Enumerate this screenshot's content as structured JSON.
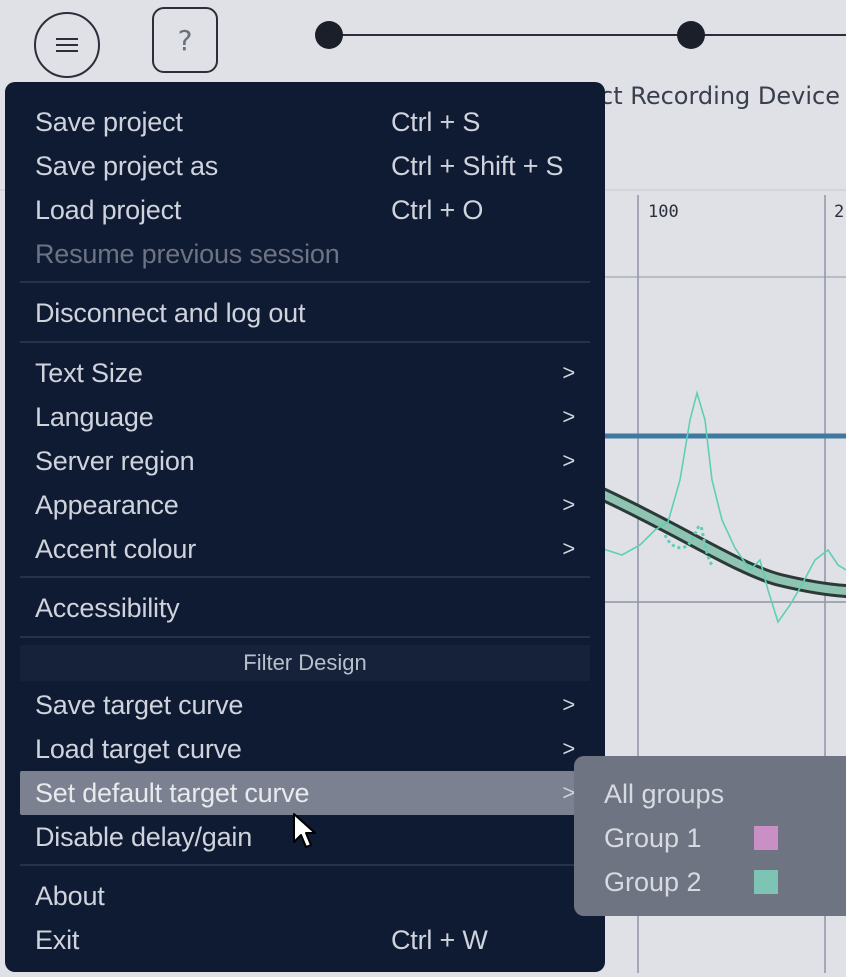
{
  "header": {
    "help_glyph": "?",
    "step_label": "ct Recording Device"
  },
  "graph": {
    "x_ticks": [
      "100",
      "2"
    ],
    "colors": {
      "grid": "#8f96a6",
      "blue_line": "#3f79a0",
      "target_curve": "#2b3a36",
      "target_curve_fill": "#8fc4b2",
      "measurement": "#5fcfb4"
    }
  },
  "menu": {
    "items": [
      {
        "label": "Save project",
        "shortcut": "Ctrl + S"
      },
      {
        "label": "Save project as",
        "shortcut": "Ctrl + Shift + S"
      },
      {
        "label": "Load project",
        "shortcut": "Ctrl + O"
      },
      {
        "label": "Resume previous session",
        "disabled": true
      },
      {
        "label": "Disconnect and log out"
      },
      {
        "label": "Text Size",
        "arrow": ">"
      },
      {
        "label": "Language",
        "arrow": ">"
      },
      {
        "label": "Server region",
        "arrow": ">"
      },
      {
        "label": "Appearance",
        "arrow": ">"
      },
      {
        "label": "Accent colour",
        "arrow": ">"
      },
      {
        "label": "Accessibility"
      },
      {
        "label": "Save target curve",
        "arrow": ">"
      },
      {
        "label": "Load target curve",
        "arrow": ">"
      },
      {
        "label": "Set default target curve",
        "arrow": ">",
        "highlighted": true
      },
      {
        "label": "Disable delay/gain"
      },
      {
        "label": "About"
      },
      {
        "label": "Exit",
        "shortcut": "Ctrl + W"
      }
    ],
    "section_header": "Filter Design",
    "colors": {
      "bg": "#0f1a33",
      "highlight": "#7b8190"
    }
  },
  "submenu": {
    "items": [
      {
        "label": "All groups"
      },
      {
        "label": "Group 1",
        "swatch": "#c890c4"
      },
      {
        "label": "Group 2",
        "swatch": "#7ec4b4"
      }
    ]
  }
}
